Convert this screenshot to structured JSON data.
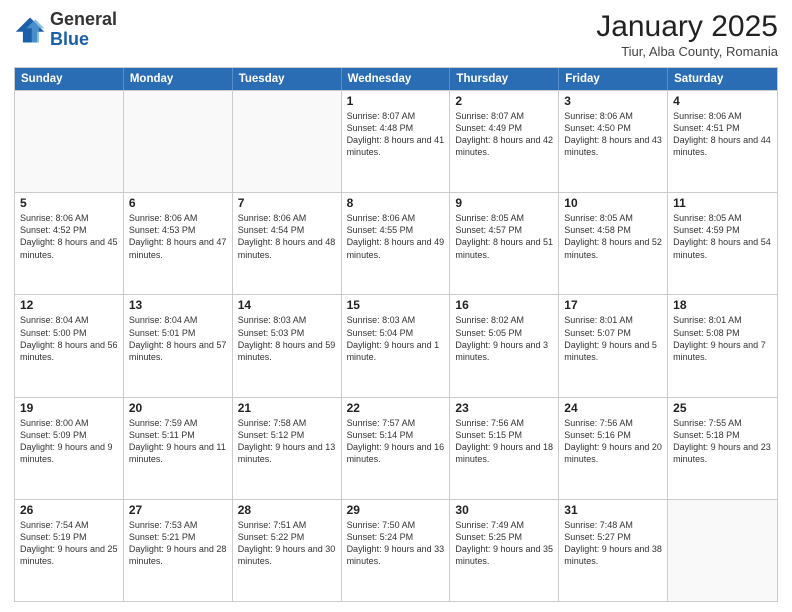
{
  "logo": {
    "general": "General",
    "blue": "Blue"
  },
  "header": {
    "month": "January 2025",
    "location": "Tiur, Alba County, Romania"
  },
  "days": [
    "Sunday",
    "Monday",
    "Tuesday",
    "Wednesday",
    "Thursday",
    "Friday",
    "Saturday"
  ],
  "rows": [
    [
      {
        "day": "",
        "empty": true
      },
      {
        "day": "",
        "empty": true
      },
      {
        "day": "",
        "empty": true
      },
      {
        "day": "1",
        "text": "Sunrise: 8:07 AM\nSunset: 4:48 PM\nDaylight: 8 hours and 41 minutes."
      },
      {
        "day": "2",
        "text": "Sunrise: 8:07 AM\nSunset: 4:49 PM\nDaylight: 8 hours and 42 minutes."
      },
      {
        "day": "3",
        "text": "Sunrise: 8:06 AM\nSunset: 4:50 PM\nDaylight: 8 hours and 43 minutes."
      },
      {
        "day": "4",
        "text": "Sunrise: 8:06 AM\nSunset: 4:51 PM\nDaylight: 8 hours and 44 minutes."
      }
    ],
    [
      {
        "day": "5",
        "text": "Sunrise: 8:06 AM\nSunset: 4:52 PM\nDaylight: 8 hours and 45 minutes."
      },
      {
        "day": "6",
        "text": "Sunrise: 8:06 AM\nSunset: 4:53 PM\nDaylight: 8 hours and 47 minutes."
      },
      {
        "day": "7",
        "text": "Sunrise: 8:06 AM\nSunset: 4:54 PM\nDaylight: 8 hours and 48 minutes."
      },
      {
        "day": "8",
        "text": "Sunrise: 8:06 AM\nSunset: 4:55 PM\nDaylight: 8 hours and 49 minutes."
      },
      {
        "day": "9",
        "text": "Sunrise: 8:05 AM\nSunset: 4:57 PM\nDaylight: 8 hours and 51 minutes."
      },
      {
        "day": "10",
        "text": "Sunrise: 8:05 AM\nSunset: 4:58 PM\nDaylight: 8 hours and 52 minutes."
      },
      {
        "day": "11",
        "text": "Sunrise: 8:05 AM\nSunset: 4:59 PM\nDaylight: 8 hours and 54 minutes."
      }
    ],
    [
      {
        "day": "12",
        "text": "Sunrise: 8:04 AM\nSunset: 5:00 PM\nDaylight: 8 hours and 56 minutes."
      },
      {
        "day": "13",
        "text": "Sunrise: 8:04 AM\nSunset: 5:01 PM\nDaylight: 8 hours and 57 minutes."
      },
      {
        "day": "14",
        "text": "Sunrise: 8:03 AM\nSunset: 5:03 PM\nDaylight: 8 hours and 59 minutes."
      },
      {
        "day": "15",
        "text": "Sunrise: 8:03 AM\nSunset: 5:04 PM\nDaylight: 9 hours and 1 minute."
      },
      {
        "day": "16",
        "text": "Sunrise: 8:02 AM\nSunset: 5:05 PM\nDaylight: 9 hours and 3 minutes."
      },
      {
        "day": "17",
        "text": "Sunrise: 8:01 AM\nSunset: 5:07 PM\nDaylight: 9 hours and 5 minutes."
      },
      {
        "day": "18",
        "text": "Sunrise: 8:01 AM\nSunset: 5:08 PM\nDaylight: 9 hours and 7 minutes."
      }
    ],
    [
      {
        "day": "19",
        "text": "Sunrise: 8:00 AM\nSunset: 5:09 PM\nDaylight: 9 hours and 9 minutes."
      },
      {
        "day": "20",
        "text": "Sunrise: 7:59 AM\nSunset: 5:11 PM\nDaylight: 9 hours and 11 minutes."
      },
      {
        "day": "21",
        "text": "Sunrise: 7:58 AM\nSunset: 5:12 PM\nDaylight: 9 hours and 13 minutes."
      },
      {
        "day": "22",
        "text": "Sunrise: 7:57 AM\nSunset: 5:14 PM\nDaylight: 9 hours and 16 minutes."
      },
      {
        "day": "23",
        "text": "Sunrise: 7:56 AM\nSunset: 5:15 PM\nDaylight: 9 hours and 18 minutes."
      },
      {
        "day": "24",
        "text": "Sunrise: 7:56 AM\nSunset: 5:16 PM\nDaylight: 9 hours and 20 minutes."
      },
      {
        "day": "25",
        "text": "Sunrise: 7:55 AM\nSunset: 5:18 PM\nDaylight: 9 hours and 23 minutes."
      }
    ],
    [
      {
        "day": "26",
        "text": "Sunrise: 7:54 AM\nSunset: 5:19 PM\nDaylight: 9 hours and 25 minutes."
      },
      {
        "day": "27",
        "text": "Sunrise: 7:53 AM\nSunset: 5:21 PM\nDaylight: 9 hours and 28 minutes."
      },
      {
        "day": "28",
        "text": "Sunrise: 7:51 AM\nSunset: 5:22 PM\nDaylight: 9 hours and 30 minutes."
      },
      {
        "day": "29",
        "text": "Sunrise: 7:50 AM\nSunset: 5:24 PM\nDaylight: 9 hours and 33 minutes."
      },
      {
        "day": "30",
        "text": "Sunrise: 7:49 AM\nSunset: 5:25 PM\nDaylight: 9 hours and 35 minutes."
      },
      {
        "day": "31",
        "text": "Sunrise: 7:48 AM\nSunset: 5:27 PM\nDaylight: 9 hours and 38 minutes."
      },
      {
        "day": "",
        "empty": true
      }
    ]
  ]
}
